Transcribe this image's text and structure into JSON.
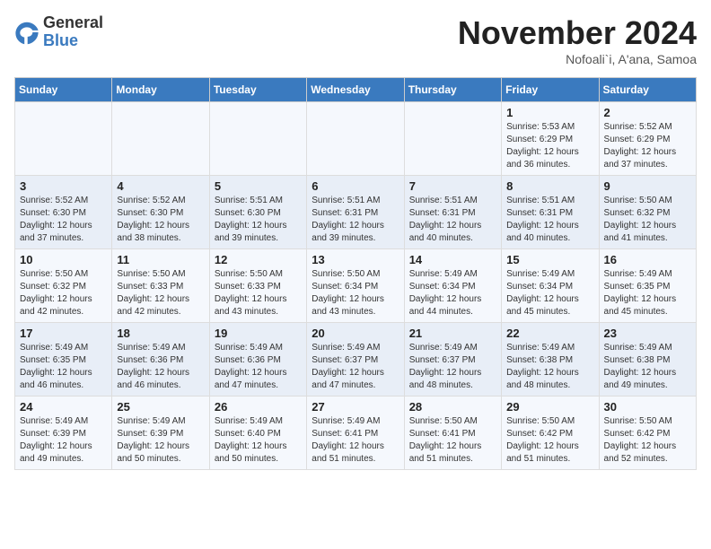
{
  "header": {
    "logo_general": "General",
    "logo_blue": "Blue",
    "month_title": "November 2024",
    "location": "Nofoali`i, A'ana, Samoa"
  },
  "days_of_week": [
    "Sunday",
    "Monday",
    "Tuesday",
    "Wednesday",
    "Thursday",
    "Friday",
    "Saturday"
  ],
  "weeks": [
    [
      {
        "day": "",
        "info": ""
      },
      {
        "day": "",
        "info": ""
      },
      {
        "day": "",
        "info": ""
      },
      {
        "day": "",
        "info": ""
      },
      {
        "day": "",
        "info": ""
      },
      {
        "day": "1",
        "info": "Sunrise: 5:53 AM\nSunset: 6:29 PM\nDaylight: 12 hours and 36 minutes."
      },
      {
        "day": "2",
        "info": "Sunrise: 5:52 AM\nSunset: 6:29 PM\nDaylight: 12 hours and 37 minutes."
      }
    ],
    [
      {
        "day": "3",
        "info": "Sunrise: 5:52 AM\nSunset: 6:30 PM\nDaylight: 12 hours and 37 minutes."
      },
      {
        "day": "4",
        "info": "Sunrise: 5:52 AM\nSunset: 6:30 PM\nDaylight: 12 hours and 38 minutes."
      },
      {
        "day": "5",
        "info": "Sunrise: 5:51 AM\nSunset: 6:30 PM\nDaylight: 12 hours and 39 minutes."
      },
      {
        "day": "6",
        "info": "Sunrise: 5:51 AM\nSunset: 6:31 PM\nDaylight: 12 hours and 39 minutes."
      },
      {
        "day": "7",
        "info": "Sunrise: 5:51 AM\nSunset: 6:31 PM\nDaylight: 12 hours and 40 minutes."
      },
      {
        "day": "8",
        "info": "Sunrise: 5:51 AM\nSunset: 6:31 PM\nDaylight: 12 hours and 40 minutes."
      },
      {
        "day": "9",
        "info": "Sunrise: 5:50 AM\nSunset: 6:32 PM\nDaylight: 12 hours and 41 minutes."
      }
    ],
    [
      {
        "day": "10",
        "info": "Sunrise: 5:50 AM\nSunset: 6:32 PM\nDaylight: 12 hours and 42 minutes."
      },
      {
        "day": "11",
        "info": "Sunrise: 5:50 AM\nSunset: 6:33 PM\nDaylight: 12 hours and 42 minutes."
      },
      {
        "day": "12",
        "info": "Sunrise: 5:50 AM\nSunset: 6:33 PM\nDaylight: 12 hours and 43 minutes."
      },
      {
        "day": "13",
        "info": "Sunrise: 5:50 AM\nSunset: 6:34 PM\nDaylight: 12 hours and 43 minutes."
      },
      {
        "day": "14",
        "info": "Sunrise: 5:49 AM\nSunset: 6:34 PM\nDaylight: 12 hours and 44 minutes."
      },
      {
        "day": "15",
        "info": "Sunrise: 5:49 AM\nSunset: 6:34 PM\nDaylight: 12 hours and 45 minutes."
      },
      {
        "day": "16",
        "info": "Sunrise: 5:49 AM\nSunset: 6:35 PM\nDaylight: 12 hours and 45 minutes."
      }
    ],
    [
      {
        "day": "17",
        "info": "Sunrise: 5:49 AM\nSunset: 6:35 PM\nDaylight: 12 hours and 46 minutes."
      },
      {
        "day": "18",
        "info": "Sunrise: 5:49 AM\nSunset: 6:36 PM\nDaylight: 12 hours and 46 minutes."
      },
      {
        "day": "19",
        "info": "Sunrise: 5:49 AM\nSunset: 6:36 PM\nDaylight: 12 hours and 47 minutes."
      },
      {
        "day": "20",
        "info": "Sunrise: 5:49 AM\nSunset: 6:37 PM\nDaylight: 12 hours and 47 minutes."
      },
      {
        "day": "21",
        "info": "Sunrise: 5:49 AM\nSunset: 6:37 PM\nDaylight: 12 hours and 48 minutes."
      },
      {
        "day": "22",
        "info": "Sunrise: 5:49 AM\nSunset: 6:38 PM\nDaylight: 12 hours and 48 minutes."
      },
      {
        "day": "23",
        "info": "Sunrise: 5:49 AM\nSunset: 6:38 PM\nDaylight: 12 hours and 49 minutes."
      }
    ],
    [
      {
        "day": "24",
        "info": "Sunrise: 5:49 AM\nSunset: 6:39 PM\nDaylight: 12 hours and 49 minutes."
      },
      {
        "day": "25",
        "info": "Sunrise: 5:49 AM\nSunset: 6:39 PM\nDaylight: 12 hours and 50 minutes."
      },
      {
        "day": "26",
        "info": "Sunrise: 5:49 AM\nSunset: 6:40 PM\nDaylight: 12 hours and 50 minutes."
      },
      {
        "day": "27",
        "info": "Sunrise: 5:49 AM\nSunset: 6:41 PM\nDaylight: 12 hours and 51 minutes."
      },
      {
        "day": "28",
        "info": "Sunrise: 5:50 AM\nSunset: 6:41 PM\nDaylight: 12 hours and 51 minutes."
      },
      {
        "day": "29",
        "info": "Sunrise: 5:50 AM\nSunset: 6:42 PM\nDaylight: 12 hours and 51 minutes."
      },
      {
        "day": "30",
        "info": "Sunrise: 5:50 AM\nSunset: 6:42 PM\nDaylight: 12 hours and 52 minutes."
      }
    ]
  ]
}
